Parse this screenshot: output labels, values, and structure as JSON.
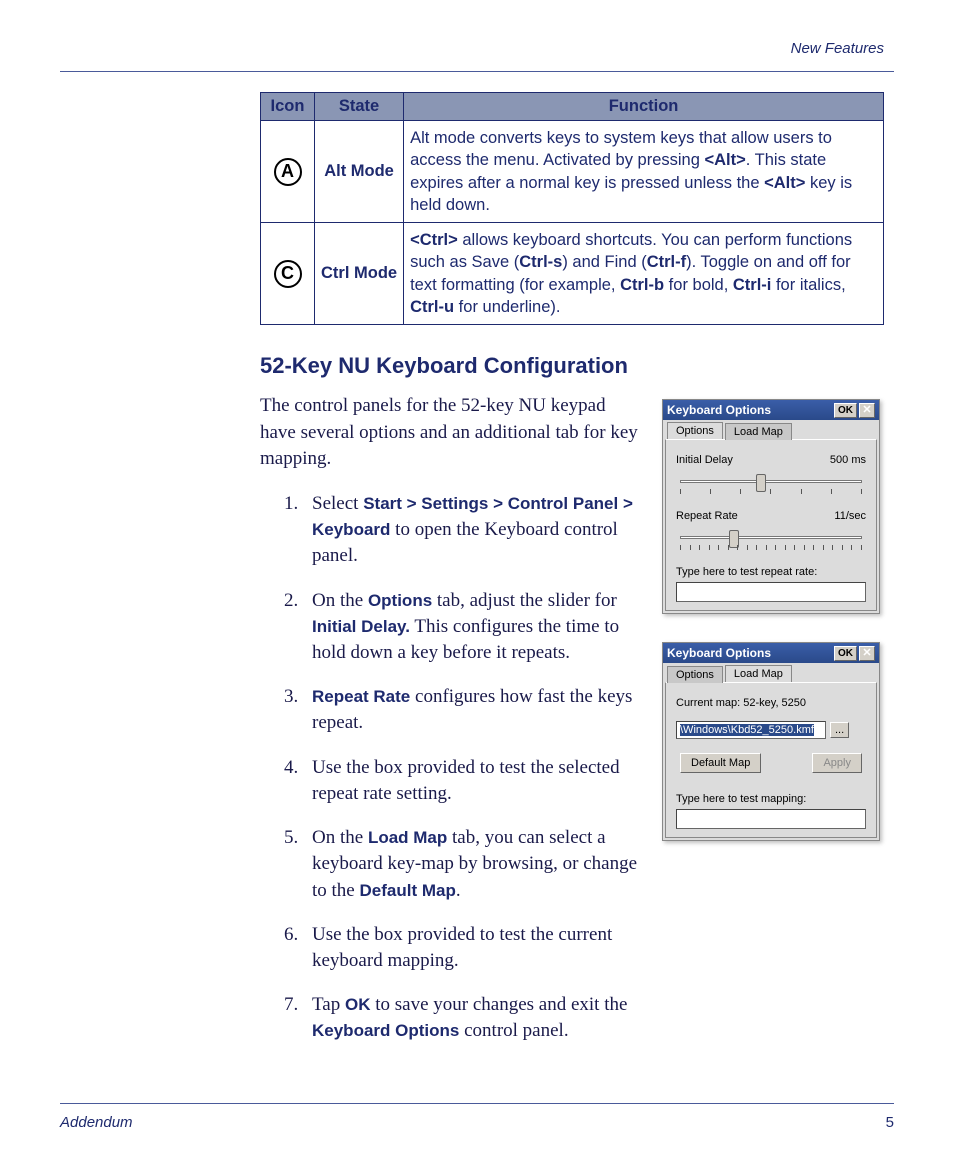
{
  "header": {
    "section": "New Features"
  },
  "table": {
    "headers": {
      "icon": "Icon",
      "state": "State",
      "function": "Function"
    },
    "rows": [
      {
        "icon_letter": "A",
        "state": "Alt Mode",
        "func_pre": "Alt mode converts keys to system keys that allow users to access the menu. Activated by pressing ",
        "k1": "<Alt>",
        "func_mid": ". This state expires after a normal key is pressed unless the ",
        "k2": "<Alt>",
        "func_post": " key is held down."
      },
      {
        "icon_letter": "C",
        "state": "Ctrl Mode",
        "c_k1": "<Ctrl>",
        "c_t1": " allows keyboard shortcuts. You can perform functions such as Save (",
        "c_k2": "Ctrl-s",
        "c_t2": ") and Find (",
        "c_k3": "Ctrl-f",
        "c_t3": "). Toggle on and off for text formatting (for example, ",
        "c_k4": "Ctrl-b",
        "c_t4": " for bold, ",
        "c_k5": "Ctrl-i",
        "c_t5": " for italics, ",
        "c_k6": "Ctrl-u",
        "c_t6": " for underline)."
      }
    ]
  },
  "section_heading": "52-Key NU Keyboard Configuration",
  "intro": "The control panels for the 52-key NU keypad have several options and an additional tab for key mapping.",
  "steps": {
    "s1a": "Select ",
    "s1b": "Start > Settings > Control Panel > Keyboard",
    "s1c": " to open the Keyboard control panel.",
    "s2a": "On the ",
    "s2b": "Options",
    "s2c": " tab, adjust the slider for ",
    "s2d": "Initial Delay.",
    "s2e": " This configures the time to hold down a key before it repeats.",
    "s3a": "Repeat Rate",
    "s3b": " configures how fast the keys repeat.",
    "s4": "Use the box provided to test the selected repeat rate setting.",
    "s5a": "On the ",
    "s5b": "Load Map",
    "s5c": " tab, you can select a keyboard key-map by browsing, or change to the ",
    "s5d": "Default Map",
    "s5e": ".",
    "s6": "Use the box provided to test the current keyboard mapping.",
    "s7a": "Tap ",
    "s7b": "OK",
    "s7c": " to save your changes and exit the ",
    "s7d": "Keyboard Options",
    "s7e": " control panel."
  },
  "dialog1": {
    "title": "Keyboard Options",
    "ok": "OK",
    "tab_options": "Options",
    "tab_loadmap": "Load Map",
    "initial_delay_label": "Initial Delay",
    "initial_delay_value": "500 ms",
    "repeat_rate_label": "Repeat Rate",
    "repeat_rate_value": "11/sec",
    "test_label": "Type here to test repeat rate:"
  },
  "dialog2": {
    "title": "Keyboard Options",
    "ok": "OK",
    "tab_options": "Options",
    "tab_loadmap": "Load Map",
    "current_map_label": "Current map: 52-key, 5250",
    "path_value": "\\Windows\\Kbd52_5250.kmf",
    "browse": "...",
    "default_map_btn": "Default Map",
    "apply_btn": "Apply",
    "test_label": "Type here to test mapping:"
  },
  "footer": {
    "doc": "Addendum",
    "page": "5"
  }
}
